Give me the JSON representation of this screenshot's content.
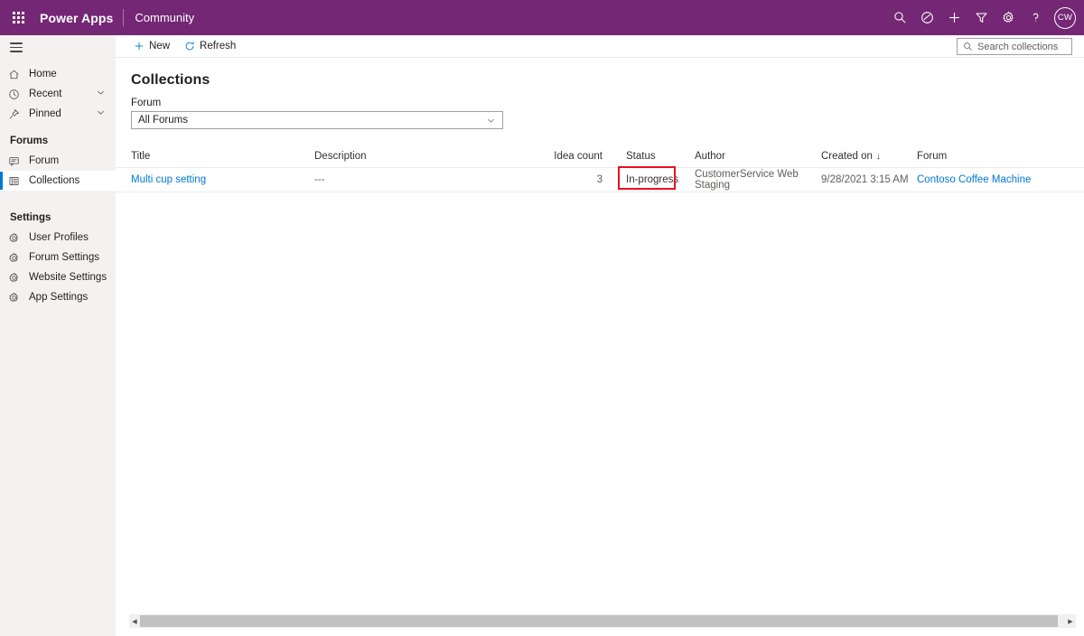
{
  "header": {
    "waffle_icon": "app-launcher-icon",
    "brand": "Power Apps",
    "app_name": "Community",
    "icons": [
      {
        "name": "search-icon",
        "glyph": "search"
      },
      {
        "name": "diagnostics-icon",
        "glyph": "circle-slash"
      },
      {
        "name": "add-icon",
        "glyph": "plus"
      },
      {
        "name": "filter-icon",
        "glyph": "funnel"
      },
      {
        "name": "settings-gear-icon",
        "glyph": "gear"
      },
      {
        "name": "help-icon",
        "glyph": "question"
      }
    ],
    "avatar_initials": "CW",
    "brand_color": "#742774"
  },
  "sidebar": {
    "hamburger_icon": "hamburger-menu-icon",
    "items": [
      {
        "label": "Home",
        "icon": "home-icon",
        "chevron": false,
        "selected": false
      },
      {
        "label": "Recent",
        "icon": "clock-icon",
        "chevron": true,
        "selected": false
      },
      {
        "label": "Pinned",
        "icon": "pin-icon",
        "chevron": true,
        "selected": false
      }
    ],
    "groups": [
      {
        "title": "Forums",
        "items": [
          {
            "label": "Forum",
            "icon": "comment-icon",
            "selected": false
          },
          {
            "label": "Collections",
            "icon": "list-icon",
            "selected": true
          }
        ]
      },
      {
        "title": "Settings",
        "items": [
          {
            "label": "User Profiles",
            "icon": "gear-icon",
            "selected": false
          },
          {
            "label": "Forum Settings",
            "icon": "gear-icon",
            "selected": false
          },
          {
            "label": "Website Settings",
            "icon": "gear-icon",
            "selected": false
          },
          {
            "label": "App Settings",
            "icon": "gear-icon",
            "selected": false
          }
        ]
      }
    ],
    "accent_color": "#0078d4"
  },
  "commandbar": {
    "new_label": "New",
    "refresh_label": "Refresh",
    "search": {
      "placeholder": "Search collections",
      "value": ""
    }
  },
  "main": {
    "page_title": "Collections",
    "filter": {
      "label": "Forum",
      "selected": "All Forums"
    },
    "table": {
      "columns": [
        {
          "key": "title",
          "label": "Title"
        },
        {
          "key": "description",
          "label": "Description"
        },
        {
          "key": "idea_count",
          "label": "Idea count"
        },
        {
          "key": "status",
          "label": "Status"
        },
        {
          "key": "author",
          "label": "Author"
        },
        {
          "key": "created_on",
          "label": "Created on",
          "sorted": "desc",
          "sort_glyph": "↓"
        },
        {
          "key": "forum",
          "label": "Forum"
        }
      ],
      "rows": [
        {
          "title": "Multi cup setting",
          "description": "---",
          "idea_count": "3",
          "status": "In-progress",
          "author": "CustomerService Web Staging",
          "created_on": "9/28/2021 3:15 AM",
          "forum": "Contoso Coffee Machine"
        }
      ]
    },
    "annotation": {
      "target": "status-cell",
      "color": "#e81123"
    }
  },
  "scrollbar": {
    "left_arrow": "◀",
    "right_arrow": "▶"
  }
}
